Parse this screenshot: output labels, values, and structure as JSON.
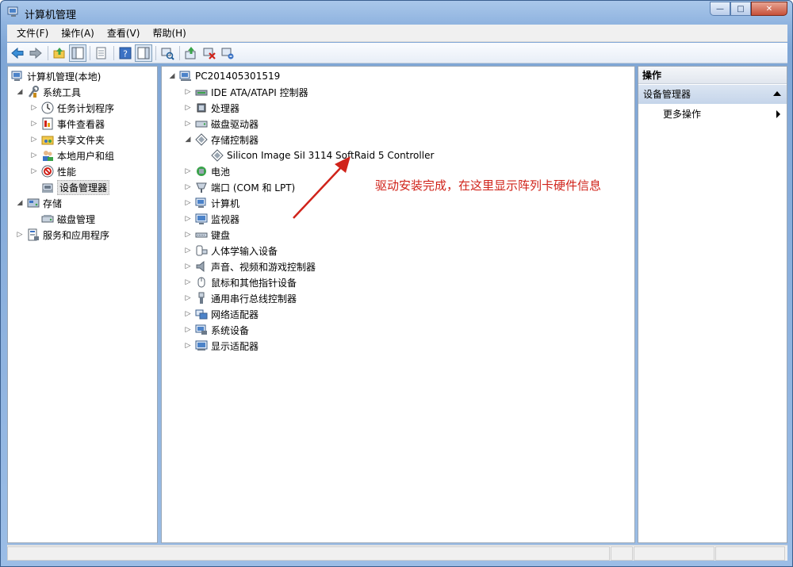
{
  "window": {
    "title": "计算机管理",
    "buttons": {
      "minimize": "—",
      "maximize": "□",
      "close": "✕"
    }
  },
  "menu": [
    {
      "label": "文件(F)"
    },
    {
      "label": "操作(A)"
    },
    {
      "label": "查看(V)"
    },
    {
      "label": "帮助(H)"
    }
  ],
  "toolbar": {
    "buttons": [
      "back-icon",
      "forward-icon",
      "up-folder-icon",
      "show-tree-icon",
      "export-icon",
      "help-icon",
      "show-action-pane-icon",
      "scan-hardware-icon",
      "update-driver-icon",
      "disable-device-icon",
      "uninstall-device-icon"
    ]
  },
  "left_tree": [
    {
      "label": "计算机管理(本地)",
      "icon": "computer-management-icon"
    },
    {
      "label": "系统工具",
      "icon": "system-tools-icon"
    },
    {
      "label": "任务计划程序",
      "icon": "clock-icon"
    },
    {
      "label": "事件查看器",
      "icon": "event-viewer-icon"
    },
    {
      "label": "共享文件夹",
      "icon": "shared-folder-icon"
    },
    {
      "label": "本地用户和组",
      "icon": "users-icon"
    },
    {
      "label": "性能",
      "icon": "performance-icon"
    },
    {
      "label": "设备管理器",
      "icon": "device-manager-icon"
    },
    {
      "label": "存储",
      "icon": "storage-icon"
    },
    {
      "label": "磁盘管理",
      "icon": "disk-management-icon"
    },
    {
      "label": "服务和应用程序",
      "icon": "services-icon"
    }
  ],
  "device_tree": {
    "root": "PC201405301519",
    "items": [
      {
        "label": "IDE ATA/ATAPI 控制器",
        "icon": "ide-controller-icon"
      },
      {
        "label": "处理器",
        "icon": "processor-icon"
      },
      {
        "label": "磁盘驱动器",
        "icon": "disk-drive-icon"
      },
      {
        "label": "存储控制器",
        "icon": "storage-controller-icon"
      },
      {
        "label": "Silicon Image SiI 3114 SoftRaid 5 Controller",
        "icon": "controller-icon"
      },
      {
        "label": "电池",
        "icon": "battery-icon"
      },
      {
        "label": "端口 (COM 和 LPT)",
        "icon": "port-icon"
      },
      {
        "label": "计算机",
        "icon": "computer-icon"
      },
      {
        "label": "监视器",
        "icon": "monitor-icon"
      },
      {
        "label": "键盘",
        "icon": "keyboard-icon"
      },
      {
        "label": "人体学输入设备",
        "icon": "hid-icon"
      },
      {
        "label": "声音、视频和游戏控制器",
        "icon": "speaker-icon"
      },
      {
        "label": "鼠标和其他指针设备",
        "icon": "mouse-icon"
      },
      {
        "label": "通用串行总线控制器",
        "icon": "usb-icon"
      },
      {
        "label": "网络适配器",
        "icon": "network-adapter-icon"
      },
      {
        "label": "系统设备",
        "icon": "system-device-icon"
      },
      {
        "label": "显示适配器",
        "icon": "display-adapter-icon"
      }
    ]
  },
  "annotation": {
    "text": "驱动安装完成，在这里显示阵列卡硬件信息",
    "color": "#d0231a"
  },
  "actions": {
    "header": "操作",
    "group": "设备管理器",
    "more": "更多操作"
  }
}
